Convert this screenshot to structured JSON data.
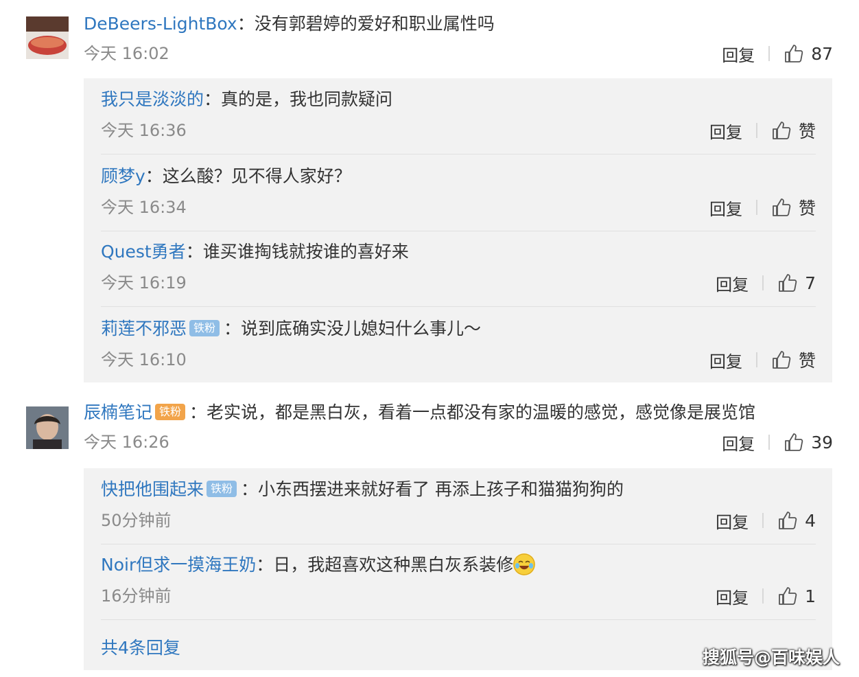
{
  "comments": [
    {
      "username": "DeBeers-LightBox",
      "text": "：没有郭碧婷的爱好和职业属性吗",
      "time": "今天 16:02",
      "reply_label": "回复",
      "likes": "87"
    },
    {
      "username": "辰楠笔记",
      "badge": "铁粉",
      "text": "：老实说，都是黑白灰，看着一点都没有家的温暖的感觉，感觉像是展览馆",
      "time": "今天 16:26",
      "reply_label": "回复",
      "likes": "39"
    }
  ],
  "replies_1": [
    {
      "username": "我只是淡淡的",
      "text": "：真的是，我也同款疑问",
      "time": "今天 16:36",
      "reply_label": "回复",
      "likes": "赞"
    },
    {
      "username": "顾梦y",
      "text": "：这么酸？见不得人家好？",
      "time": "今天 16:34",
      "reply_label": "回复",
      "likes": "赞"
    },
    {
      "username": "Quest勇者",
      "text": "：谁买谁掏钱就按谁的喜好来",
      "time": "今天 16:19",
      "reply_label": "回复",
      "likes": "7"
    },
    {
      "username": "莉莲不邪恶",
      "badge": "铁粉",
      "text": "：说到底确实没儿媳妇什么事儿～",
      "time": "今天 16:10",
      "reply_label": "回复",
      "likes": "赞"
    }
  ],
  "replies_2": [
    {
      "username": "快把他围起来",
      "badge": "铁粉",
      "text": "：小东西摆进来就好看了 再添上孩子和猫猫狗狗的",
      "time": "50分钟前",
      "reply_label": "回复",
      "likes": "4"
    },
    {
      "username": "Noir但求一摸海王奶",
      "text": "：日，我超喜欢这种黑白灰系装修",
      "emoji": "crying-laughing-emoji",
      "time": "16分钟前",
      "reply_label": "回复",
      "likes": "1"
    }
  ],
  "more_replies": "共4条回复",
  "watermark": "搜狐号@百味娱人",
  "colors": {
    "username": "#2f77bf",
    "reply_bg": "#f2f2f2",
    "time": "#8a8a8a"
  }
}
